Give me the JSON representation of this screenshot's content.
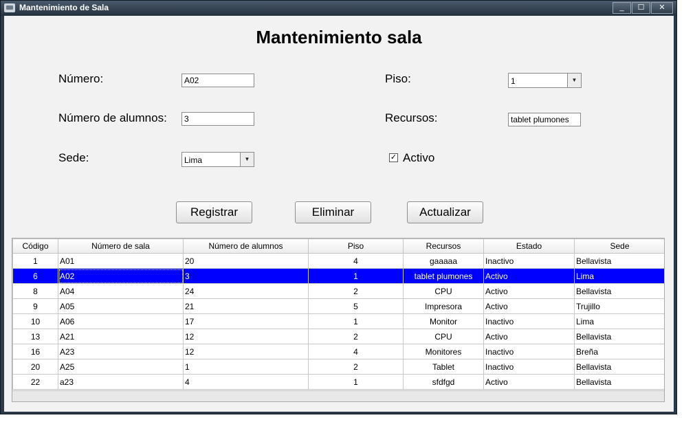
{
  "window": {
    "title": "Mantenimiento de Sala",
    "min_glyph": "_",
    "max_glyph": "☐",
    "close_glyph": "✕"
  },
  "form": {
    "heading": "Mantenimiento sala",
    "numero_label": "Número:",
    "numero_value": "A02",
    "alumnos_label": "Número de alumnos:",
    "alumnos_value": "3",
    "sede_label": "Sede:",
    "sede_value": "Lima",
    "piso_label": "Piso:",
    "piso_value": "1",
    "recursos_label": "Recursos:",
    "recursos_value": "tablet plumones",
    "activo_label": "Activo",
    "activo_checked": true
  },
  "buttons": {
    "registrar": "Registrar",
    "eliminar": "Eliminar",
    "actualizar": "Actualizar"
  },
  "table": {
    "columns": [
      "Código",
      "Número de sala",
      "Número de alumnos",
      "Piso",
      "Recursos",
      "Estado",
      "Sede"
    ],
    "selected_row": 1,
    "rows": [
      [
        "1",
        "A01",
        "20",
        "4",
        "gaaaaa",
        "Inactivo",
        "Bellavista"
      ],
      [
        "6",
        "A02",
        "3",
        "1",
        "tablet plumones",
        "Activo",
        "Lima"
      ],
      [
        "8",
        "A04",
        "24",
        "2",
        "CPU",
        "Activo",
        "Bellavista"
      ],
      [
        "9",
        "A05",
        "21",
        "5",
        "Impresora",
        "Activo",
        "Trujillo"
      ],
      [
        "10",
        "A06",
        "17",
        "1",
        "Monitor",
        "Inactivo",
        "Lima"
      ],
      [
        "13",
        "A21",
        "12",
        "2",
        "CPU",
        "Activo",
        "Bellavista"
      ],
      [
        "16",
        "A23",
        "12",
        "4",
        "Monitores",
        "Inactivo",
        "Breña"
      ],
      [
        "20",
        "A25",
        "1",
        "2",
        "Tablet",
        "Inactivo",
        "Bellavista"
      ],
      [
        "22",
        "a23",
        "4",
        "1",
        "sfdfgd",
        "Activo",
        "Bellavista"
      ]
    ]
  },
  "icons": {
    "app": "window-app-icon",
    "dropdown": "chevron-down-icon",
    "check": "checkmark-icon"
  }
}
